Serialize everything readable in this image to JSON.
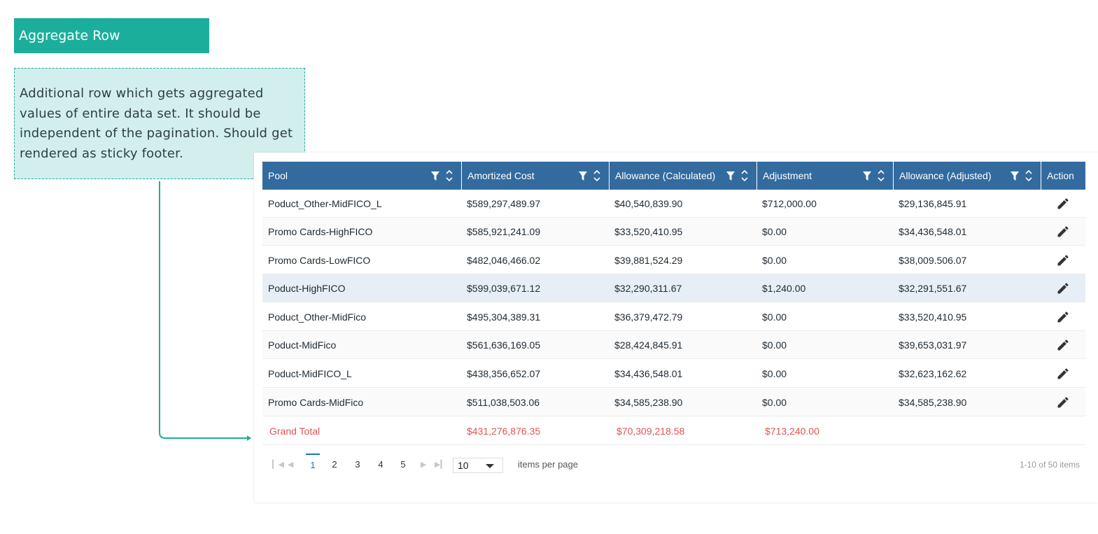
{
  "annotation": {
    "title": "Aggregate Row",
    "description": "Additional row which gets aggregated values of entire data set. It should be independent of the pagination. Should get rendered as sticky footer."
  },
  "grid": {
    "columns": [
      {
        "label": "Pool",
        "filter_icon": "filter-icon",
        "sort_icon": "sort-icon"
      },
      {
        "label": "Amortized Cost",
        "filter_icon": "filter-icon",
        "sort_icon": "sort-icon"
      },
      {
        "label": "Allowance (Calculated)",
        "filter_icon": "filter-icon",
        "sort_icon": "sort-icon"
      },
      {
        "label": "Adjustment",
        "filter_icon": "filter-icon",
        "sort_icon": "sort-icon"
      },
      {
        "label": "Allowance (Adjusted)",
        "filter_icon": "filter-icon",
        "sort_icon": "sort-icon"
      },
      {
        "label": "Action"
      }
    ],
    "rows": [
      [
        "Poduct_Other-MidFICO_L",
        "$589,297,489.97",
        "$40,540,839.90",
        "$712,000.00",
        "$29,136,845.91"
      ],
      [
        "Promo Cards-HighFICO",
        "$585,921,241.09",
        "$33,520,410.95",
        "$0.00",
        "$34,436,548.01"
      ],
      [
        "Promo Cards-LowFICO",
        "$482,046,466.02",
        "$39,881,524.29",
        "$0.00",
        "$38,009.506.07"
      ],
      [
        "Poduct-HighFICO",
        "$599,039,671.12",
        "$32,290,311.67",
        "$1,240.00",
        "$32,291,551.67"
      ],
      [
        "Poduct_Other-MidFico",
        "$495,304,389.31",
        "$36,379,472.79",
        "$0.00",
        "$33,520,410.95"
      ],
      [
        "Poduct-MidFico",
        "$561,636,169.05",
        "$28,424,845.91",
        "$0.00",
        "$39,653,031.97"
      ],
      [
        "Poduct-MidFICO_L",
        "$438,356,652.07",
        "$34,436,548.01",
        "$0.00",
        "$32,623,162.62"
      ],
      [
        "Promo Cards-MidFico",
        "$511,038,503.06",
        "$34,585,238.90",
        "$0.00",
        "$34,585,238.90"
      ]
    ],
    "edit_icon": "pencil-icon",
    "aggregate": {
      "label": "Grand Total",
      "amortized_cost": "$431,276,876.35",
      "allowance_calculated": "$70,309,218.58",
      "adjustment": "$713,240.00"
    }
  },
  "pager": {
    "pages": [
      "1",
      "2",
      "3",
      "4",
      "5"
    ],
    "active_page": "1",
    "page_size": "10",
    "items_per_page_label": "items per page",
    "info": "1-10 of 50 items"
  },
  "colors": {
    "header_bg": "#346b9f",
    "accent": "#1baf9b",
    "total_text": "#e0534f",
    "active_page": "#1a73b5"
  }
}
